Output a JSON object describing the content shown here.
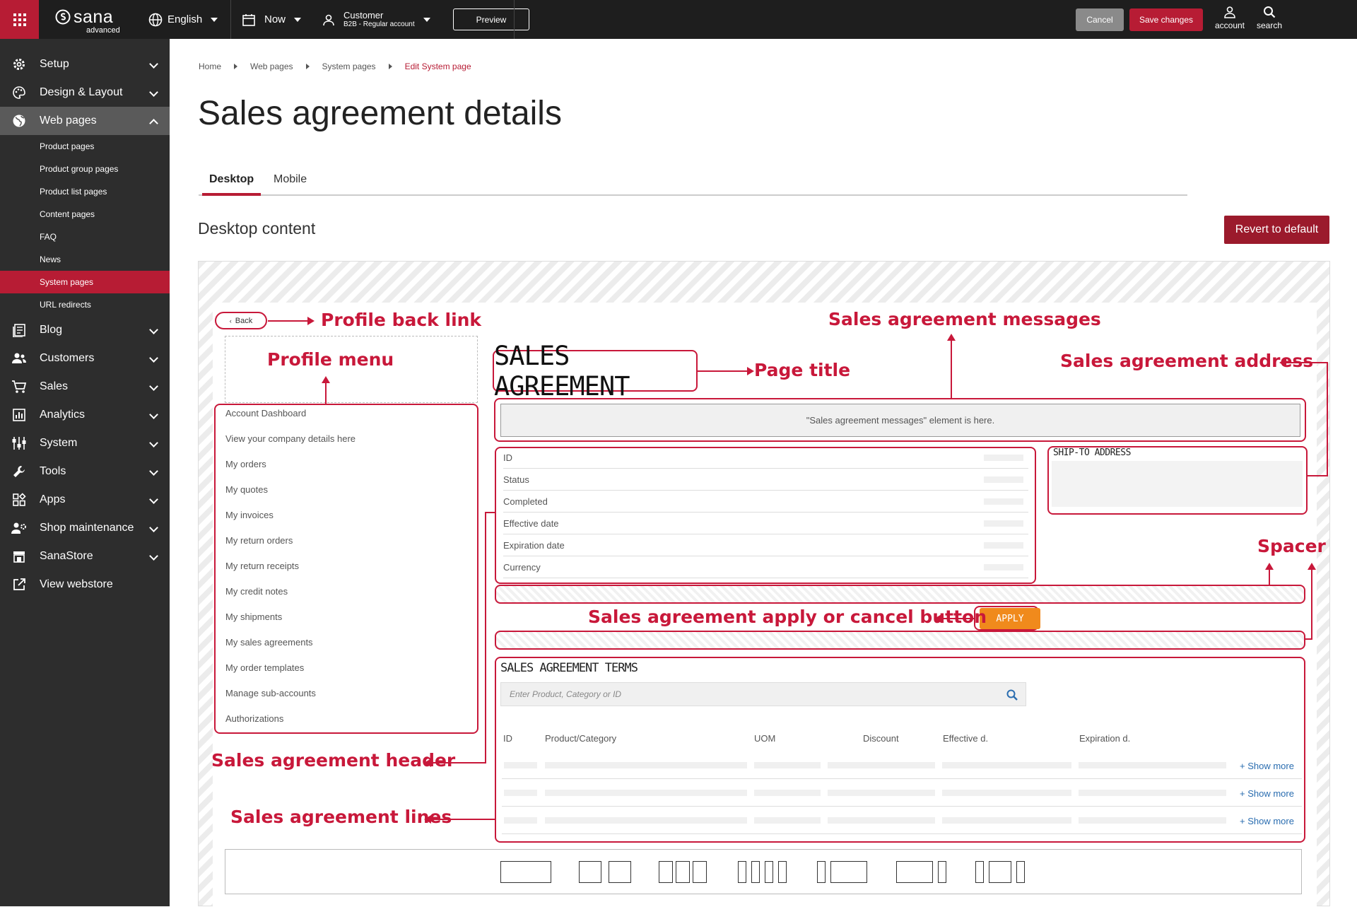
{
  "topbar": {
    "brand": "sana",
    "brand_sub": "advanced",
    "language": "English",
    "date": "Now",
    "customer_title": "Customer",
    "customer_sub": "B2B - Regular account",
    "preview": "Preview",
    "cancel": "Cancel",
    "save": "Save changes",
    "account": "account",
    "search": "search"
  },
  "sidebar": {
    "items": [
      {
        "label": "Setup",
        "icon": "gear-icon"
      },
      {
        "label": "Design & Layout",
        "icon": "palette-icon"
      },
      {
        "label": "Web pages",
        "icon": "globe-icon"
      },
      {
        "label": "Blog",
        "icon": "blog-icon"
      },
      {
        "label": "Customers",
        "icon": "users-icon"
      },
      {
        "label": "Sales",
        "icon": "cart-icon"
      },
      {
        "label": "Analytics",
        "icon": "chart-icon"
      },
      {
        "label": "System",
        "icon": "sliders-icon"
      },
      {
        "label": "Tools",
        "icon": "wrench-icon"
      },
      {
        "label": "Apps",
        "icon": "apps-icon"
      },
      {
        "label": "Shop maintenance",
        "icon": "maintenance-icon"
      },
      {
        "label": "SanaStore",
        "icon": "store-icon"
      },
      {
        "label": "View webstore",
        "icon": "external-link-icon"
      }
    ],
    "web_pages_sub": [
      "Product pages",
      "Product group pages",
      "Product list pages",
      "Content pages",
      "FAQ",
      "News",
      "System pages",
      "URL redirects"
    ]
  },
  "breadcrumb": [
    "Home",
    "Web pages",
    "System pages",
    "Edit System page"
  ],
  "page_title": "Sales agreement details",
  "tabs": [
    "Desktop",
    "Mobile"
  ],
  "section_title": "Desktop content",
  "revert_button": "Revert to default",
  "preview": {
    "back": "Back",
    "profile_menu": [
      "Account Dashboard",
      "View your company details here",
      "My orders",
      "My quotes",
      "My invoices",
      "My return orders",
      "My return receipts",
      "My credit notes",
      "My shipments",
      "My sales agreements",
      "My order templates",
      "Manage sub-accounts",
      "Authorizations"
    ],
    "title": "SALES AGREEMENT",
    "messages_text": "\"Sales agreement messages\" element is here.",
    "header_fields": [
      "ID",
      "Status",
      "Completed",
      "Effective date",
      "Expiration date",
      "Currency"
    ],
    "ship_to": "SHIP-TO ADDRESS",
    "apply": "APPLY",
    "terms_title": "SALES AGREEMENT TERMS",
    "search_placeholder": "Enter Product, Category or ID",
    "columns": [
      "ID",
      "Product/Category",
      "UOM",
      "Discount",
      "Effective d.",
      "Expiration d."
    ],
    "show_more": "+ Show more"
  },
  "annotations": {
    "back_link": "Profile back link",
    "profile_menu": "Profile menu",
    "page_title": "Page title",
    "messages": "Sales agreement messages",
    "address": "Sales agreement address",
    "spacer": "Spacer",
    "apply_cancel": "Sales agreement apply or cancel button",
    "header": "Sales agreement header",
    "lines": "Sales agreement lines"
  },
  "colors": {
    "accent": "#b71c34",
    "annotation": "#c8183a",
    "apply": "#f08a1c",
    "sidebar": "#2d2d2d",
    "topbar": "#1e1e1e"
  }
}
